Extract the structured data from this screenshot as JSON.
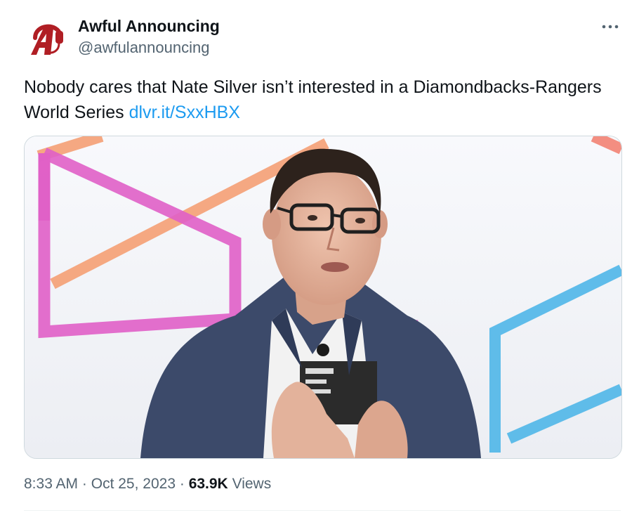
{
  "author": {
    "display_name": "Awful Announcing",
    "handle": "@awfulannouncing",
    "avatar_icon": "awful-announcing-logo",
    "brand_color": "#b01e24"
  },
  "tweet": {
    "text": "Nobody cares that Nate Silver isn’t interested in a Diamondbacks-Rangers World Series ",
    "link": "dlvr.it/SxxHBX",
    "link_color": "#1d9bf0",
    "media_icon": "photo-of-man-speaking"
  },
  "meta": {
    "time": "8:33 AM",
    "separator": "·",
    "date": "Oct 25, 2023",
    "views_count": "63.9K",
    "views_label": "Views"
  },
  "menu": {
    "more_icon": "more-dots-icon"
  }
}
